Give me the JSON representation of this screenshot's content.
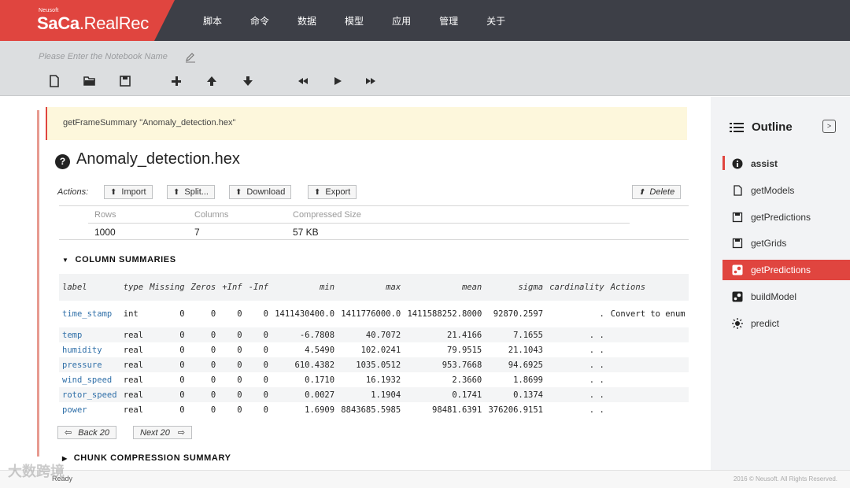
{
  "app": {
    "logo_small": "Neusoft",
    "logo_main_a": "Sa",
    "logo_main_b": "Ca",
    "logo_main_c": ".RealRec",
    "brand_color": "#e0453f",
    "nav": [
      "脚本",
      "命令",
      "数据",
      "模型",
      "应用",
      "管理",
      "关于"
    ]
  },
  "toolbar": {
    "notebook_placeholder": "Please Enter the Notebook Name",
    "tools": [
      "new-file-icon",
      "open-folder-icon",
      "save-icon",
      "add-icon",
      "move-up-icon",
      "move-down-icon",
      "rewind-icon",
      "play-icon",
      "fast-forward-icon"
    ]
  },
  "cell": {
    "command": "getFrameSummary \"Anomaly_detection.hex\""
  },
  "frame": {
    "help_glyph": "?",
    "title": "Anomaly_detection.hex",
    "actions_label": "Actions:",
    "buttons": [
      "Import",
      "Split...",
      "Download",
      "Export"
    ],
    "delete_label": "Delete",
    "stats": {
      "labels": [
        "Rows",
        "Columns",
        "Compressed Size"
      ],
      "values": [
        "1000",
        "7",
        "57 KB"
      ]
    }
  },
  "column_summaries": {
    "title": "COLUMN SUMMARIES",
    "headers": [
      "label",
      "type",
      "Missing",
      "Zeros",
      "+Inf",
      "-Inf",
      "min",
      "max",
      "mean",
      "sigma",
      "cardinality",
      "Actions"
    ],
    "rows": [
      [
        "time_stamp",
        "int",
        "0",
        "0",
        "0",
        "0",
        "1411430400.0",
        "1411776000.0",
        "1411588252.8000",
        "92870.2597",
        ".",
        "Convert to enum"
      ],
      [
        "temp",
        "real",
        "0",
        "0",
        "0",
        "0",
        "-6.7808",
        "40.7072",
        "21.4166",
        "7.1655",
        ". .",
        ""
      ],
      [
        "humidity",
        "real",
        "0",
        "0",
        "0",
        "0",
        "4.5490",
        "102.0241",
        "79.9515",
        "21.1043",
        ". .",
        ""
      ],
      [
        "pressure",
        "real",
        "0",
        "0",
        "0",
        "0",
        "610.4382",
        "1035.0512",
        "953.7668",
        "94.6925",
        ". .",
        ""
      ],
      [
        "wind_speed",
        "real",
        "0",
        "0",
        "0",
        "0",
        "0.1710",
        "16.1932",
        "2.3660",
        "1.8699",
        ". .",
        ""
      ],
      [
        "rotor_speed",
        "real",
        "0",
        "0",
        "0",
        "0",
        "0.0027",
        "1.1904",
        "0.1741",
        "0.1374",
        ". .",
        ""
      ],
      [
        "power",
        "real",
        "0",
        "0",
        "0",
        "0",
        "1.6909",
        "8843685.5985",
        "98481.6391",
        "376206.9151",
        ". .",
        ""
      ]
    ],
    "back_label": "Back 20",
    "next_label": "Next 20"
  },
  "chunk_summary": {
    "title": "CHUNK COMPRESSION SUMMARY"
  },
  "outline": {
    "title": "Outline",
    "toggle": ">",
    "items": [
      {
        "label": "assist",
        "icon": "info-icon"
      },
      {
        "label": "getModels",
        "icon": "document-icon"
      },
      {
        "label": "getPredictions",
        "icon": "save-icon"
      },
      {
        "label": "getGrids",
        "icon": "save-icon"
      },
      {
        "label": "getPredictions",
        "icon": "steam-icon"
      },
      {
        "label": "buildModel",
        "icon": "steam-icon"
      },
      {
        "label": "predict",
        "icon": "sun-icon"
      }
    ]
  },
  "status": {
    "text": "Ready",
    "copyright": "2016 © Neusoft. All Rights Reserved."
  },
  "watermark": "大数跨境"
}
